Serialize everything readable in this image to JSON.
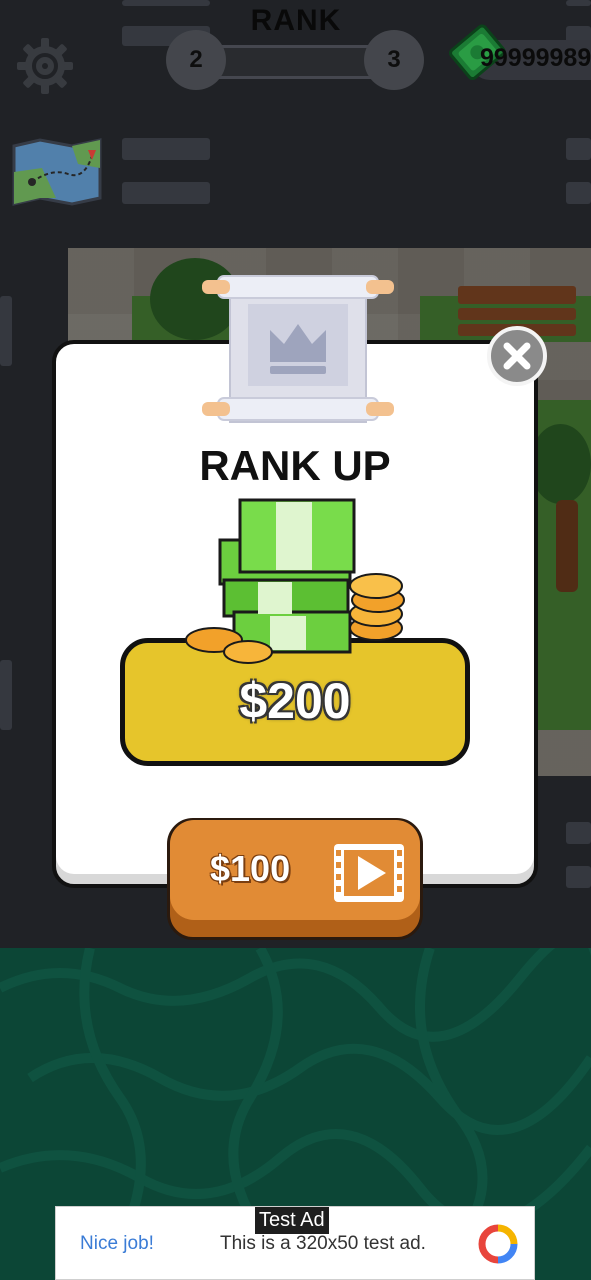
{
  "hud": {
    "rank_title": "RANK",
    "current_rank": "2",
    "next_rank": "3",
    "rank_progress": 0.04,
    "money": "99999989"
  },
  "popup": {
    "title": "RANK UP",
    "reward": "$200",
    "ad_button_label": "$100"
  },
  "ad": {
    "label": "Test Ad",
    "headline": "Nice job!",
    "description": "This is a 320x50 test ad."
  },
  "colors": {
    "reward_panel": "#e6c52b",
    "ad_button": "#e18b35",
    "bottom_area": "#0c4636",
    "progress_fill": "#6fc24a"
  },
  "icons": [
    "gear-icon",
    "map-icon",
    "cash-icon",
    "scroll-crown-icon",
    "close-icon",
    "money-stack-icon",
    "video-play-icon",
    "ad-logo-icon"
  ]
}
